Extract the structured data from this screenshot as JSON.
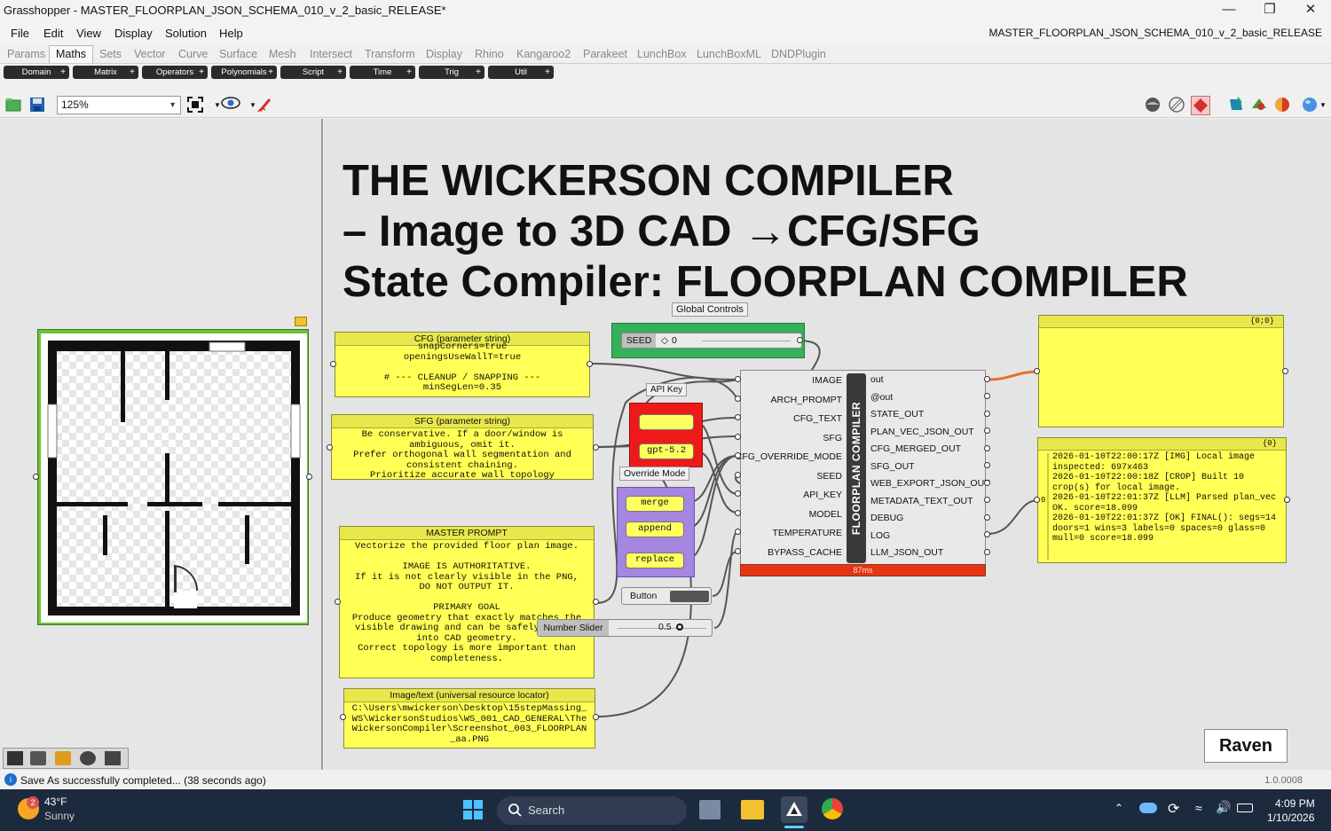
{
  "window": {
    "title": "Grasshopper - MASTER_FLOORPLAN_JSON_SCHEMA_010_v_2_basic_RELEASE*",
    "document_name": "MASTER_FLOORPLAN_JSON_SCHEMA_010_v_2_basic_RELEASE"
  },
  "menu": [
    "File",
    "Edit",
    "View",
    "Display",
    "Solution",
    "Help"
  ],
  "tabs": [
    "Params",
    "Maths",
    "Sets",
    "Vector",
    "Curve",
    "Surface",
    "Mesh",
    "Intersect",
    "Transform",
    "Display",
    "Rhino",
    "Kangaroo2",
    "Parakeet",
    "LunchBox",
    "LunchBoxML",
    "DNDPlugin"
  ],
  "active_tab": "Maths",
  "subtabs": [
    "Domain",
    "Matrix",
    "Operators",
    "Polynomials",
    "Script",
    "Time",
    "Trig",
    "Util"
  ],
  "toolbar": {
    "zoom": "125%"
  },
  "canvas": {
    "title_lines": [
      "THE WICKERSON COMPILER",
      "– Image to 3D CAD →CFG/SFG",
      "State Compiler: FLOORPLAN COMPILER"
    ],
    "global_controls_label": "Global Controls",
    "seed_slider": {
      "label": "SEED",
      "value": "0"
    },
    "api_key_label": "API Key",
    "model_value": "gpt-5.2",
    "override_mode_label": "Override Mode",
    "override_options": [
      "merge",
      "append",
      "replace"
    ],
    "button_label": "Button",
    "temperature_slider": {
      "label": "Number Slider",
      "value": "0.5"
    },
    "cfg_panel": {
      "header": "CFG (parameter string)",
      "body": "snapCorners=true\nopeningsUseWallT=true\n\n# --- CLEANUP / SNAPPING ---\nminSegLen=0.35"
    },
    "sfg_panel": {
      "header": "SFG (parameter string)",
      "body": "Be conservative. If a door/window is ambiguous, omit it.\nPrefer orthogonal wall segmentation and consistent chaining.\nPrioritize accurate wall topology"
    },
    "prompt_panel": {
      "header": "MASTER PROMPT",
      "body": "Vectorize the provided floor plan image.\n\nIMAGE IS AUTHORITATIVE.\nIf it is not clearly visible in the PNG,\nDO NOT OUTPUT IT.\n\nPRIMARY GOAL\nProduce geometry that exactly matches the visible drawing and can be safely lifted into CAD geometry.\nCorrect topology is more important than completeness."
    },
    "url_panel": {
      "header": "Image/text (universal resource locator)",
      "body": "C:\\Users\\mwickerson\\Desktop\\15stepMassing_WS\\WickersonStudios\\WS_001_CAD_GENERAL\\TheWickersonCompiler\\Screenshot_003_FLOORPLAN_aa.PNG"
    },
    "component": {
      "name": "FLOORPLAN COMPILER",
      "inputs": [
        "IMAGE",
        "ARCH_PROMPT",
        "CFG_TEXT",
        "SFG",
        "CFG_OVERRIDE_MODE",
        "SEED",
        "API_KEY",
        "MODEL",
        "TEMPERATURE",
        "BYPASS_CACHE"
      ],
      "outputs": [
        "out",
        "@out",
        "STATE_OUT",
        "PLAN_VEC_JSON_OUT",
        "CFG_MERGED_OUT",
        "SFG_OUT",
        "WEB_EXPORT_JSON_OUT",
        "METADATA_TEXT_OUT",
        "DEBUG",
        "LOG",
        "LLM_JSON_OUT"
      ],
      "timing": "87ms"
    },
    "empty_panel": {
      "path": "{0;0}"
    },
    "log_panel": {
      "path": "{0}",
      "index": "0",
      "body": "2026-01-10T22:00:17Z [IMG] Local image inspected: 697x463\n2026-01-10T22:00:18Z [CROP] Built 10 crop(s) for local image.\n2026-01-10T22:01:37Z [LLM] Parsed plan_vec OK. score=18.099\n2026-01-10T22:01:37Z [OK] FINAL(): segs=14 doors=1 wins=3 labels=0 spaces=0 glass=0 mull=0 score=18.099"
    },
    "raven_label": "Raven"
  },
  "status": {
    "message": "Save As successfully completed... (38 seconds ago)",
    "version": "1.0.0008"
  },
  "taskbar": {
    "weather_temp": "43°F",
    "weather_desc": "Sunny",
    "weather_badge": "2",
    "search_placeholder": "Search",
    "time": "4:09 PM",
    "date": "1/10/2026"
  },
  "colors": {
    "panel_yellow": "#ffff55",
    "api_red": "#ee1a1a",
    "override_purple": "#a586e0",
    "global_green": "#35b15a",
    "timing_red": "#e53512",
    "wire_orange": "#e86f2b"
  }
}
